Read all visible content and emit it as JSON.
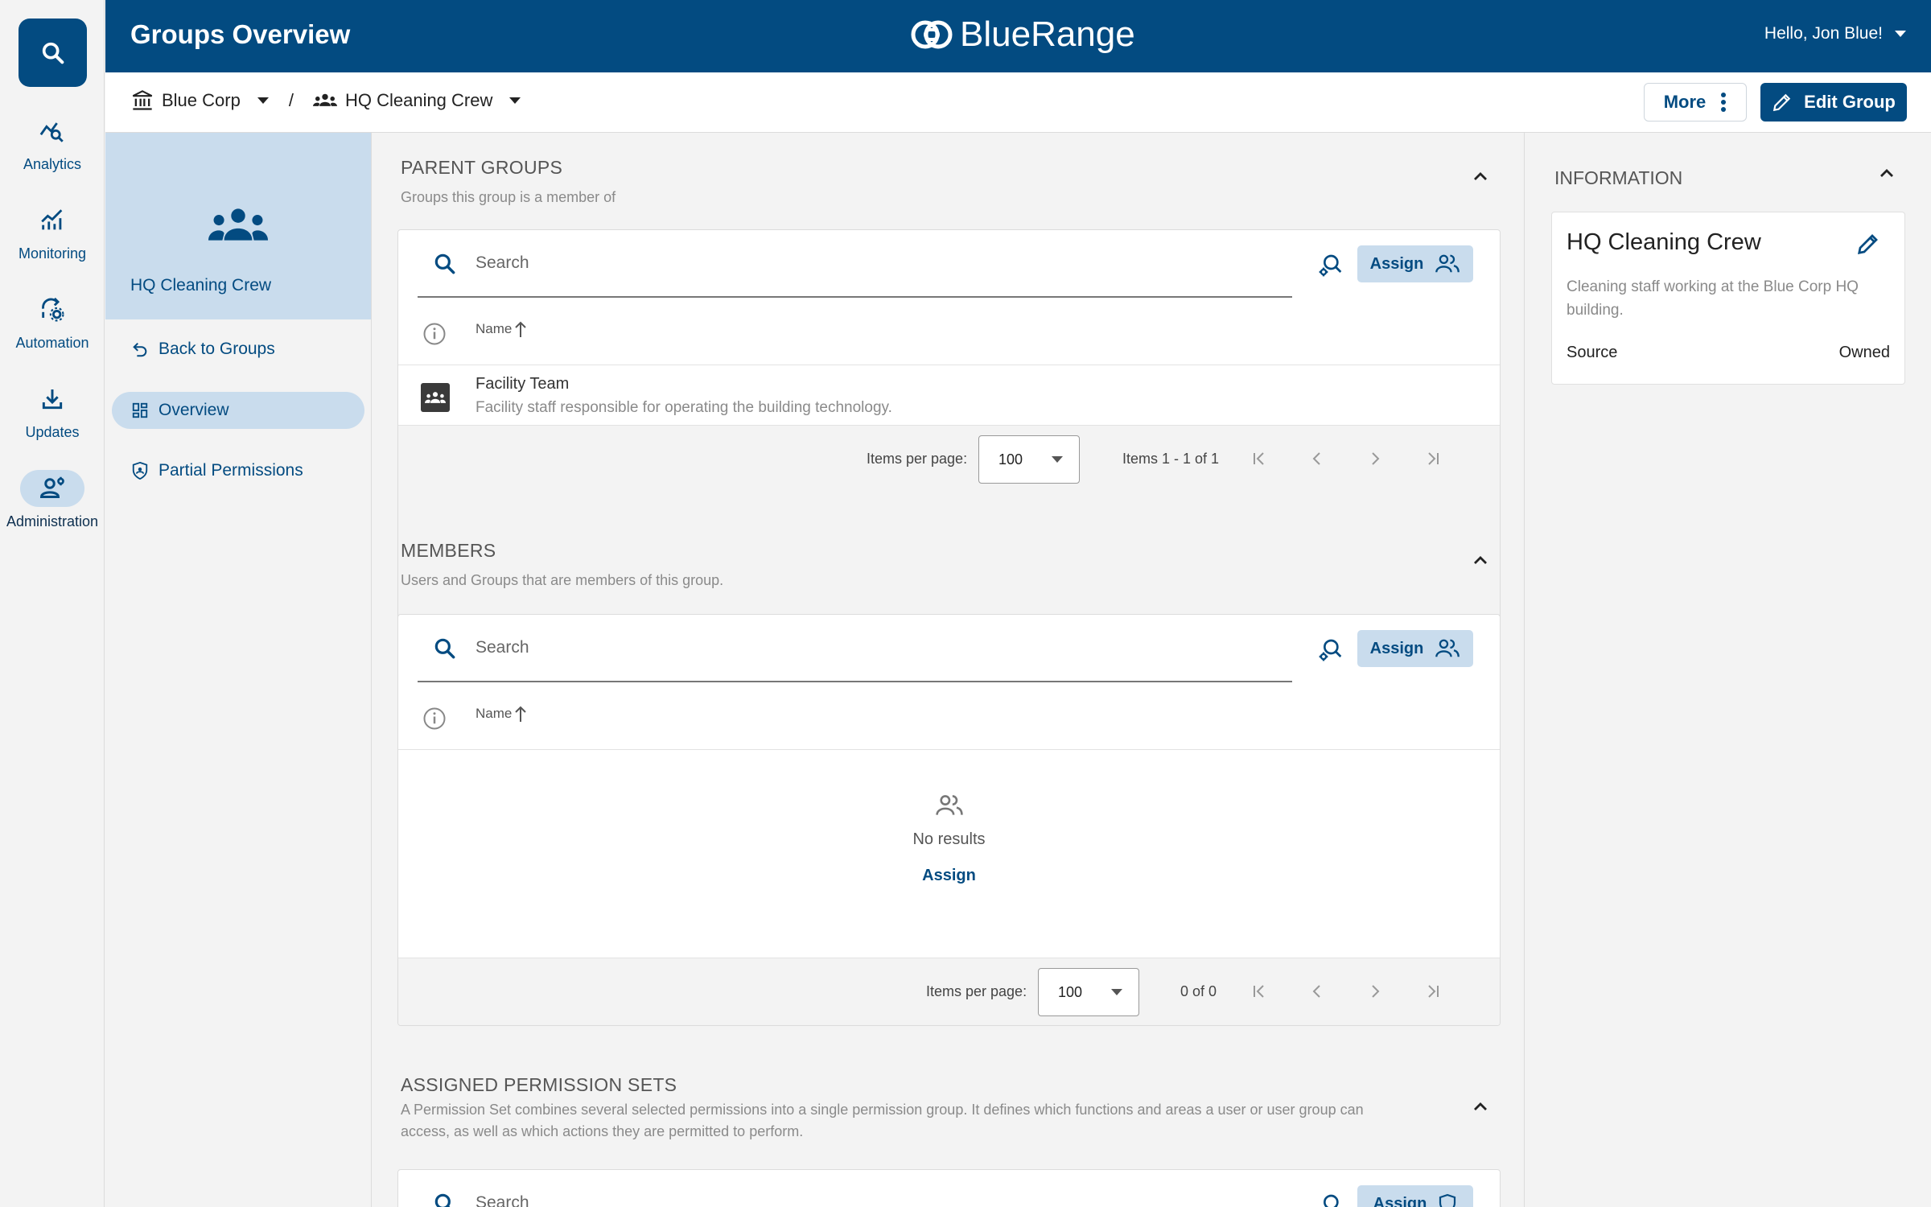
{
  "header": {
    "title": "Groups Overview",
    "brand": "BlueRange",
    "greeting": "Hello, Jon Blue!"
  },
  "rail": {
    "items": [
      {
        "label": "Analytics",
        "icon": "analytics-icon"
      },
      {
        "label": "Monitoring",
        "icon": "monitoring-icon"
      },
      {
        "label": "Automation",
        "icon": "automation-icon"
      },
      {
        "label": "Updates",
        "icon": "download-icon"
      },
      {
        "label": "Administration",
        "icon": "admin-icon",
        "active": true
      }
    ]
  },
  "breadcrumb": {
    "org": "Blue Corp",
    "separator": "/",
    "group": "HQ Cleaning Crew"
  },
  "toolbar": {
    "more_label": "More",
    "edit_label": "Edit Group"
  },
  "nav": {
    "group_name": "HQ Cleaning Crew",
    "links": [
      {
        "label": "Back to Groups",
        "icon": "back-icon"
      },
      {
        "label": "Overview",
        "icon": "dashboard-icon",
        "active": true
      },
      {
        "label": "Partial Permissions",
        "icon": "shield-icon"
      }
    ]
  },
  "parent_groups": {
    "title": "PARENT GROUPS",
    "subtitle": "Groups this group is a member of",
    "search_placeholder": "Search",
    "assign_label": "Assign",
    "col_name": "Name",
    "rows": [
      {
        "name": "Facility Team",
        "description": "Facility staff responsible for operating the building technology."
      }
    ],
    "items_per_page_label": "Items per page:",
    "items_per_page": "100",
    "range": "Items 1 - 1 of 1"
  },
  "members": {
    "title": "MEMBERS",
    "subtitle": "Users and Groups that are members of this group.",
    "search_placeholder": "Search",
    "assign_label": "Assign",
    "col_name": "Name",
    "empty_text": "No results",
    "empty_link": "Assign",
    "items_per_page_label": "Items per page:",
    "items_per_page": "100",
    "range": "0 of 0"
  },
  "permission_sets": {
    "title": "ASSIGNED PERMISSION SETS",
    "subtitle": "A Permission Set combines several selected permissions into a single permission group. It defines which functions and areas a user or user group can access, as well as which actions they are permitted to perform.",
    "search_placeholder": "Search",
    "assign_label": "Assign"
  },
  "information": {
    "title": "INFORMATION",
    "name": "HQ Cleaning Crew",
    "description": "Cleaning staff working at the Blue Corp HQ building.",
    "source_label": "Source",
    "source_value": "Owned"
  },
  "colors": {
    "primary": "#034b81",
    "accent_light": "#c9dced",
    "background": "#f3f3f3"
  }
}
